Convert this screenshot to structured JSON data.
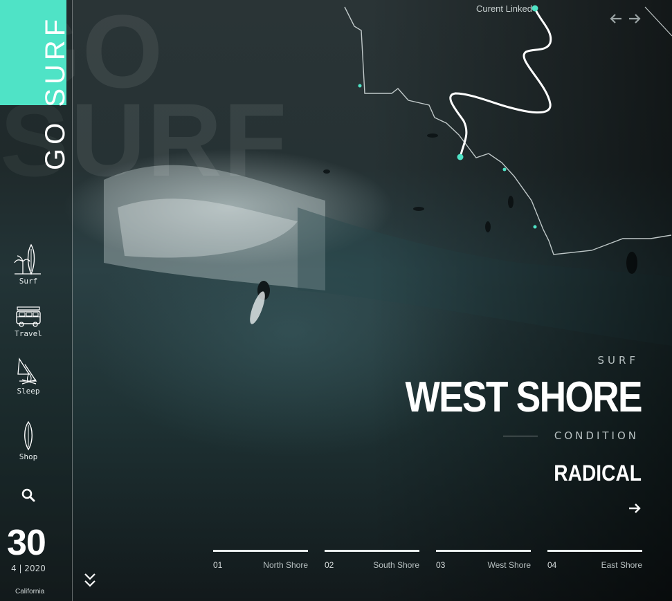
{
  "brand": {
    "name": "GO SURF",
    "accent_color": "#4fe3c6"
  },
  "sidebar": {
    "items": [
      {
        "label": "Surf",
        "icon": "surfboard-palm-icon"
      },
      {
        "label": "Travel",
        "icon": "van-icon"
      },
      {
        "label": "Sleep",
        "icon": "tent-campfire-icon"
      },
      {
        "label": "Shop",
        "icon": "surfboard-icon"
      }
    ],
    "search_icon": "search-icon"
  },
  "date": {
    "day": "30",
    "month_year": "4 | 2020",
    "location": "California"
  },
  "map": {
    "current_label": "Curent Linked"
  },
  "nav_arrows": {
    "prev_icon": "arrow-left-icon",
    "next_icon": "arrow-right-icon"
  },
  "hero": {
    "kicker": "SURF",
    "title": "WEST SHORE",
    "condition_label": "CONDITION",
    "condition_value": "RADICAL"
  },
  "shores": [
    {
      "num": "01",
      "name": "North Shore"
    },
    {
      "num": "02",
      "name": "South Shore"
    },
    {
      "num": "03",
      "name": "West Shore"
    },
    {
      "num": "04",
      "name": "East Shore"
    }
  ]
}
